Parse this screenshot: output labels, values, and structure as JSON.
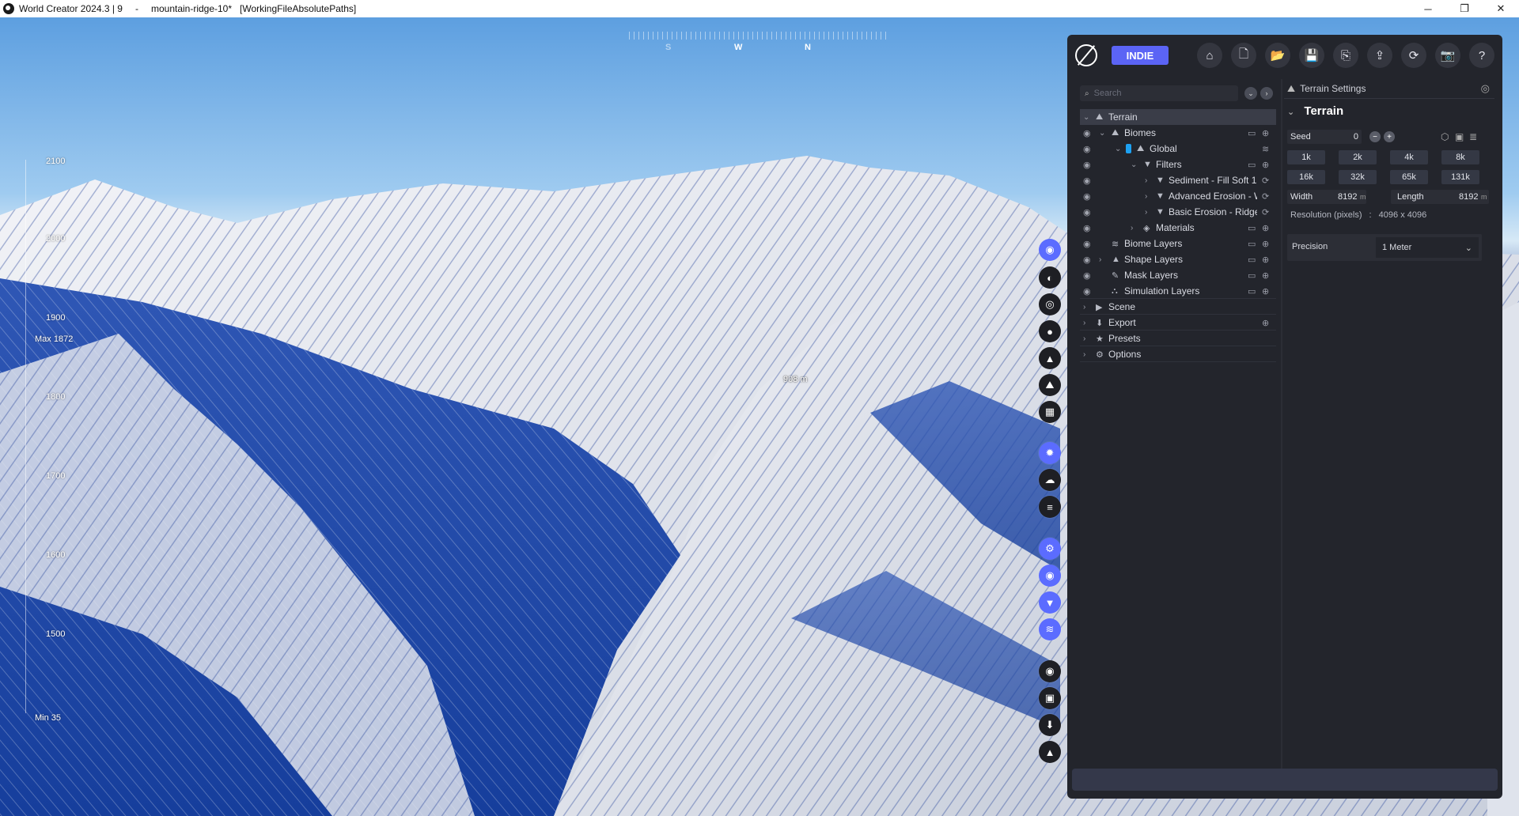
{
  "window": {
    "app_title": "World Creator 2024.3 | 9",
    "separator": "-",
    "file_name": "mountain-ridge-10*",
    "path_tag": "[WorkingFileAbsolutePaths]",
    "controls": {
      "minimize": "─",
      "maximize": "❐",
      "close": "✕"
    }
  },
  "viewport": {
    "compass": {
      "s": "S",
      "w": "W",
      "n": "N"
    },
    "height_scale": {
      "labels": [
        "2100",
        "2000",
        "1900",
        "1800",
        "1700",
        "1600",
        "1500"
      ],
      "max_label": "Max 1872",
      "min_label": "Min 35"
    },
    "cursor_height": "908 m"
  },
  "vertical_toolbar": [
    {
      "name": "navigation",
      "icon": "compass-icon",
      "glyph": "◉"
    },
    {
      "name": "planet",
      "icon": "globe-icon",
      "glyph": "◐"
    },
    {
      "name": "biome",
      "icon": "biome-icon",
      "glyph": "◎"
    },
    {
      "name": "water",
      "icon": "drop-icon",
      "glyph": "●"
    },
    {
      "name": "mountain",
      "icon": "mountain-icon",
      "glyph": "▲"
    },
    {
      "name": "terrain-shape",
      "icon": "hill-icon",
      "glyph": "⛰"
    },
    {
      "name": "grid",
      "icon": "grid-icon",
      "glyph": "▦"
    },
    {
      "name": "sun",
      "icon": "sun-icon",
      "glyph": "✹"
    },
    {
      "name": "clouds",
      "icon": "cloud-icon",
      "glyph": "☁"
    },
    {
      "name": "fog",
      "icon": "fog-icon",
      "glyph": "≡"
    },
    {
      "name": "settings",
      "icon": "cogs-icon",
      "glyph": "⚙"
    },
    {
      "name": "visibility",
      "icon": "eye-icon",
      "glyph": "◉"
    },
    {
      "name": "filter",
      "icon": "filter-icon",
      "glyph": "▼"
    },
    {
      "name": "layers",
      "icon": "layers-icon",
      "glyph": "≋"
    },
    {
      "name": "render",
      "icon": "disc-icon",
      "glyph": "◉"
    },
    {
      "name": "image",
      "icon": "image-icon",
      "glyph": "▣"
    },
    {
      "name": "download",
      "icon": "download-icon",
      "glyph": "⬇"
    },
    {
      "name": "stats",
      "icon": "chart-icon",
      "glyph": "▲"
    }
  ],
  "panel": {
    "badge": "INDIE",
    "toolbar": [
      {
        "icon": "home-icon",
        "glyph": "⌂"
      },
      {
        "icon": "new-file-icon",
        "glyph": "🗋"
      },
      {
        "icon": "open-folder-icon",
        "glyph": "📂"
      },
      {
        "icon": "save-icon",
        "glyph": "💾"
      },
      {
        "icon": "save-as-icon",
        "glyph": "⎘"
      },
      {
        "icon": "export-icon",
        "glyph": "⇪"
      },
      {
        "icon": "sync-icon",
        "glyph": "⟳"
      },
      {
        "icon": "camera-icon",
        "glyph": "📷"
      },
      {
        "icon": "help-icon",
        "glyph": "?"
      }
    ],
    "search_placeholder": "Search",
    "tree": [
      {
        "label": "Terrain"
      },
      {
        "label": "Biomes"
      },
      {
        "label": "Global"
      },
      {
        "label": "Filters"
      },
      {
        "label": "Sediment - Fill Soft 1"
      },
      {
        "label": "Advanced Erosion - W"
      },
      {
        "label": "Basic Erosion - Ridged"
      },
      {
        "label": "Materials"
      },
      {
        "label": "Biome Layers"
      },
      {
        "label": "Shape Layers"
      },
      {
        "label": "Mask Layers"
      },
      {
        "label": "Simulation Layers"
      },
      {
        "label": "Scene"
      },
      {
        "label": "Export"
      },
      {
        "label": "Presets"
      },
      {
        "label": "Options"
      }
    ],
    "settings": {
      "header": "Terrain Settings",
      "title": "Terrain",
      "seed_label": "Seed",
      "seed_value": "0",
      "resolutions": [
        "1k",
        "2k",
        "4k",
        "8k",
        "16k",
        "32k",
        "65k",
        "131k"
      ],
      "width_label": "Width",
      "width_value": "8192",
      "length_label": "Length",
      "length_value": "8192",
      "unit": "m",
      "resolution_label": "Resolution (pixels)",
      "resolution_colon": ":",
      "resolution_value": "4096 x 4096",
      "precision_label": "Precision",
      "precision_value": "1 Meter"
    }
  }
}
